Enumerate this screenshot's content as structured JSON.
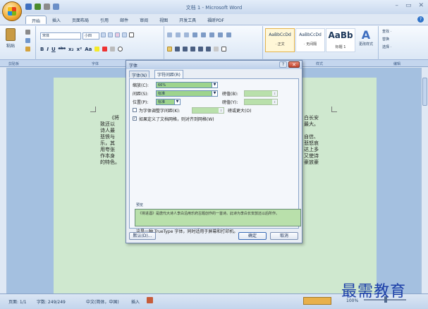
{
  "window": {
    "title": "文档 1 - Microsoft Word",
    "controls": [
      "–",
      "▭",
      "✕"
    ]
  },
  "ribbon_tabs": [
    "开始",
    "插入",
    "页面布局",
    "引用",
    "邮件",
    "审阅",
    "视图",
    "开发工具",
    "福昕PDF"
  ],
  "ribbon": {
    "paste_label": "粘贴",
    "font_name": "宋体",
    "font_size": "小四",
    "fmt_buttons": [
      "B",
      "I",
      "U",
      "abe",
      "x₂",
      "x²",
      "Aa"
    ],
    "styles": [
      {
        "sample": "AaBbCcDd",
        "name": "· 正文"
      },
      {
        "sample": "AaBbCcDd",
        "name": "· 无间隔"
      },
      {
        "sample": "AaBb",
        "name": "标题 1"
      }
    ],
    "change_style_label": "更改样式",
    "edit_items": [
      "查找 ·",
      "替换",
      "选择 ·"
    ],
    "group_labels": [
      "剪贴板",
      "字体",
      "段落",
      "样式",
      "编辑"
    ]
  },
  "document": {
    "lines": [
      "《将",
      "致还以 ",
      "诗人最 ",
      "悲愤与 ",
      "乐，其 ",
      "用夸张 ",
      "作本身 ",
      "的特色。"
    ],
    "right_lines": [
      "白长安",
      "最大。",
      "自信、",
      "悲怒哀",
      "达上多",
      "又使诗",
      "豪放豪"
    ]
  },
  "dialog": {
    "title": "字体",
    "help_label": "?",
    "close_label": "✕",
    "tabs": [
      "字体(N)",
      "字符间距(R)"
    ],
    "rows": {
      "scale_label": "缩放(C):",
      "scale_value": "66%",
      "spacing_label": "间距(S):",
      "spacing_value": "标准",
      "spacing_by_label": "磅值(B):",
      "position_label": "位置(P):",
      "position_value": "标准",
      "position_by_label": "磅值(Y):",
      "kerning_label": "为字体调整字间距(K):",
      "kerning_suffix": "磅或更大(O)",
      "grid_label": "如果定义了文档网格，则对齐到网格(W)"
    },
    "preview": {
      "label": "预览",
      "text": "《将进酒》是唐代大诗人李白沿用乐府古题创作的一首诗。此诗为李白长安放还以后所作。",
      "note": "这是一种 TrueType 字体，同时适用于屏幕和打印机。"
    },
    "buttons": {
      "default": "默认(D)...",
      "ok": "确定",
      "cancel": "取消"
    }
  },
  "statusbar": {
    "page": "页面: 1/1",
    "words": "字数: 249/249",
    "language": "中文(简体，中国)",
    "mode": "插入",
    "zoom": "100%"
  },
  "watermark": "最需教育"
}
